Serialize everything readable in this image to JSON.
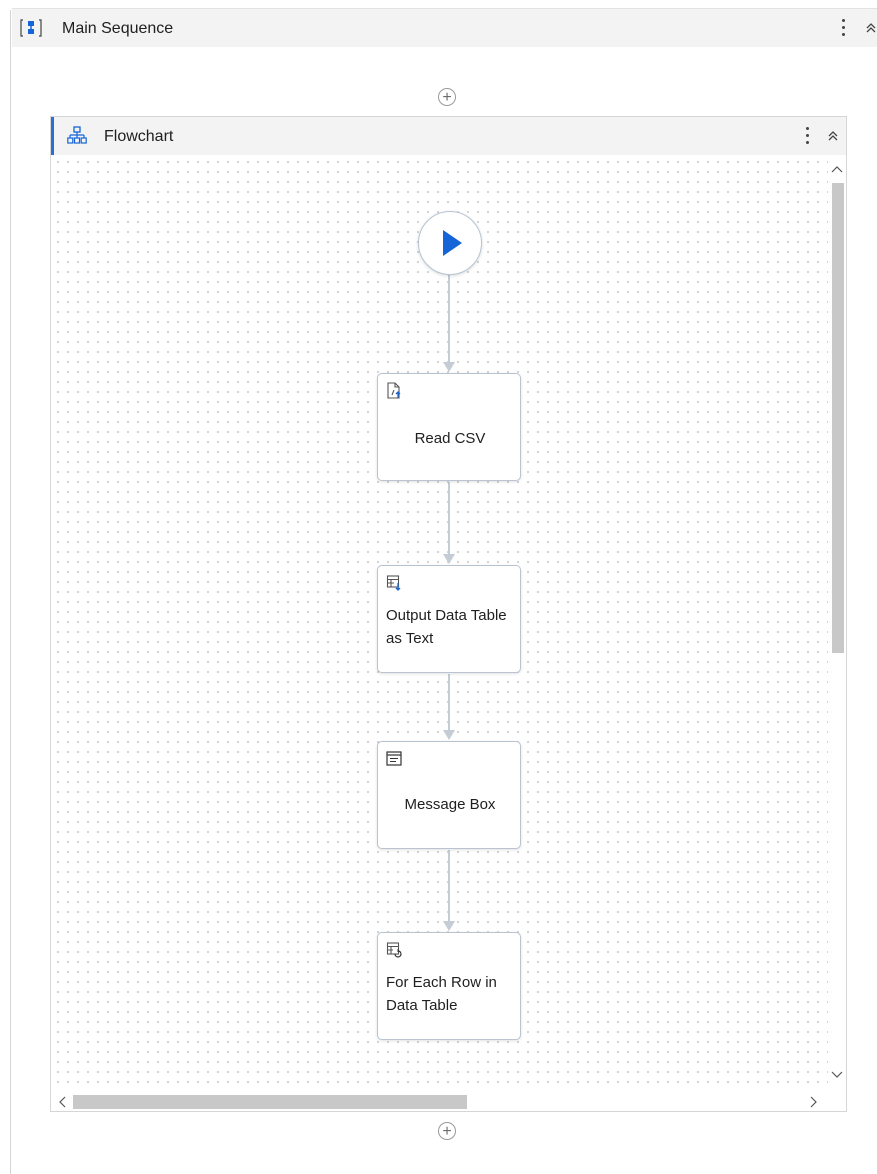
{
  "main_sequence": {
    "title": "Main Sequence",
    "icon": "sequence-icon",
    "menu_icon": "more-vertical-icon",
    "collapse_icon": "collapse-up-icon"
  },
  "add_activity": {
    "symbol": "+"
  },
  "flowchart": {
    "title": "Flowchart",
    "icon": "flowchart-icon",
    "menu_icon": "more-vertical-icon",
    "collapse_icon": "collapse-up-icon",
    "start_icon": "play-icon",
    "activities": [
      {
        "label": "Read CSV",
        "icon": "read-csv-icon"
      },
      {
        "label": "Output Data Table as Text",
        "icon": "output-data-table-icon"
      },
      {
        "label": "Message Box",
        "icon": "message-box-icon"
      },
      {
        "label": "For Each Row in Data Table",
        "icon": "for-each-row-icon"
      }
    ]
  },
  "colors": {
    "accent": "#2b6fd6",
    "play": "#1565d8",
    "connector": "#c4ccd6",
    "header_bg": "#f3f3f3"
  }
}
